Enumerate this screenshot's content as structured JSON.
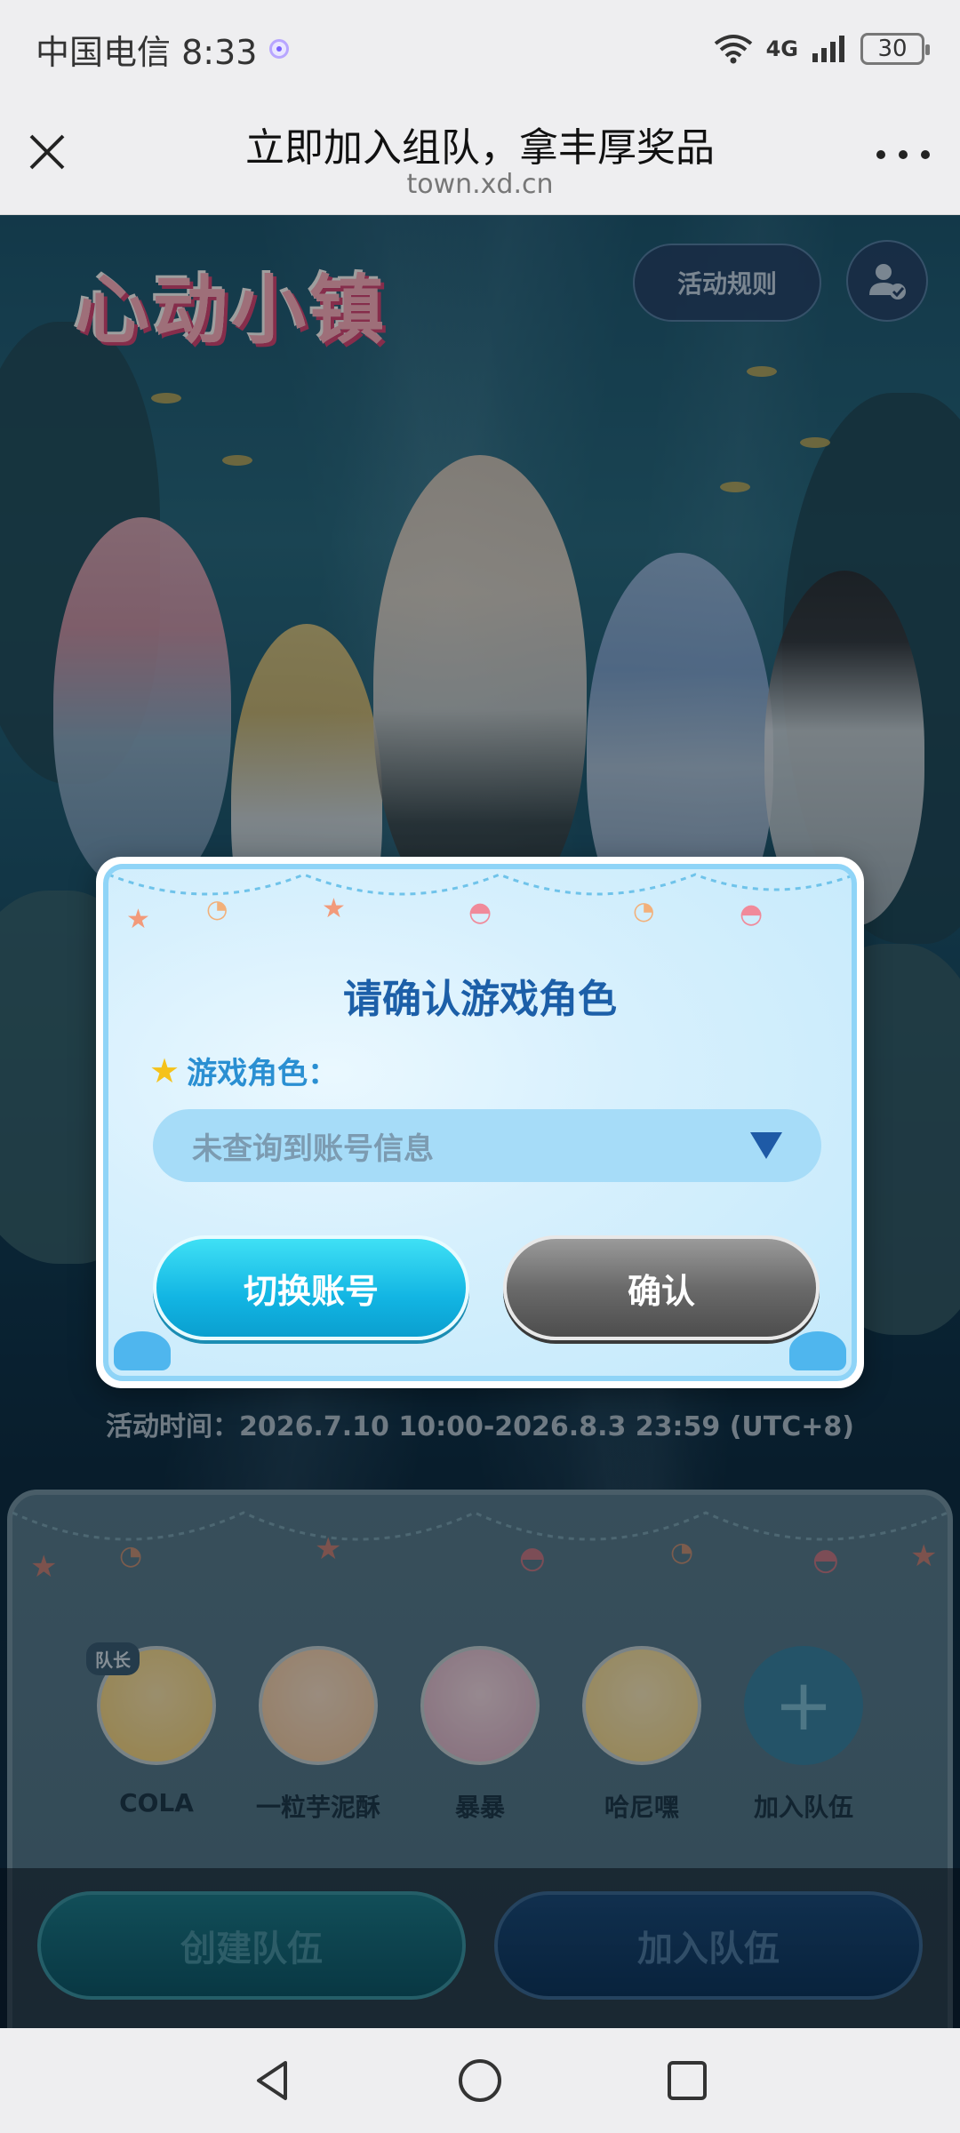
{
  "status_bar": {
    "carrier_time": "中国电信 8:33",
    "network": "4G",
    "wifi_level": "6",
    "battery": "30"
  },
  "title_bar": {
    "title": "立即加入组队，拿丰厚奖品",
    "url": "town.xd.cn"
  },
  "page": {
    "logo_text": "心动小镇",
    "rules_button": "活动规则",
    "activity_time": "活动时间：2026.7.10 10:00-2026.8.3 23:59 (UTC+8)",
    "team": {
      "leader_badge": "队长",
      "members": [
        {
          "name": "COLA",
          "color": "#f3d37a"
        },
        {
          "name": "一粒芋泥酥",
          "color": "#f1c9a0"
        },
        {
          "name": "暴暴",
          "color": "#d9b2c9"
        },
        {
          "name": "哈尼嘿",
          "color": "#f2d889"
        }
      ],
      "add_label": "加入队伍",
      "add_symbol": "+"
    },
    "create_team_button": "创建队伍",
    "join_team_button": "加入队伍"
  },
  "modal": {
    "title": "请确认游戏角色",
    "role_label": "游戏角色：",
    "role_placeholder": "未查询到账号信息",
    "switch_account_button": "切换账号",
    "confirm_button": "确认"
  },
  "colors": {
    "accent_blue": "#1c5fa8",
    "switch_button": "#12b5e3",
    "confirm_button": "#6a6a6a"
  }
}
